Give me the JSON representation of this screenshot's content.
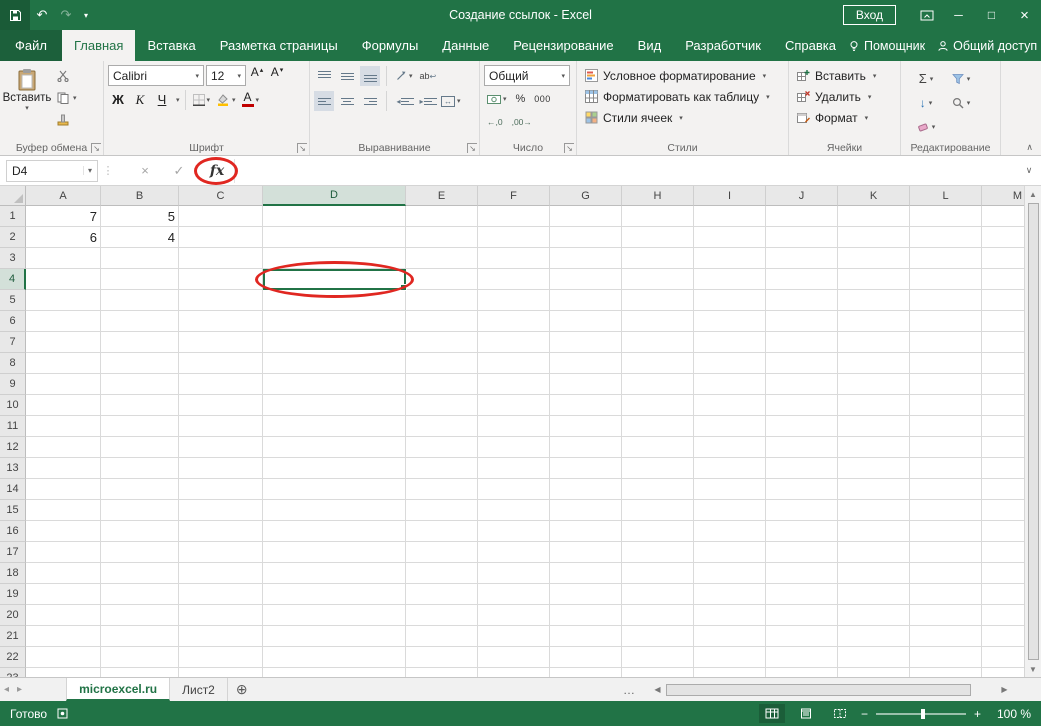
{
  "colors": {
    "accent": "#217346",
    "titlebar": "#217346",
    "ribbon_bg": "#F3F2F1",
    "annotation": "#E02721"
  },
  "titlebar": {
    "title": "Создание ссылок - Excel",
    "signin": "Вход"
  },
  "ribbon_tabs": {
    "file": "Файл",
    "active": "Главная",
    "items": [
      "Главная",
      "Вставка",
      "Разметка страницы",
      "Формулы",
      "Данные",
      "Рецензирование",
      "Вид",
      "Разработчик",
      "Справка"
    ],
    "assistant": "Помощник",
    "share": "Общий доступ"
  },
  "ribbon": {
    "clipboard": {
      "group": "Буфер обмена",
      "paste": "Вставить"
    },
    "font": {
      "group": "Шрифт",
      "family": "Calibri",
      "size": "12",
      "bold": "Ж",
      "italic": "К",
      "underline": "Ч"
    },
    "alignment": {
      "group": "Выравнивание",
      "wrap": "ab"
    },
    "number": {
      "group": "Число",
      "format": "Общий",
      "percent": "%",
      "thousands": "000",
      "dec_inc": "←,0",
      "dec_dec": ",00→"
    },
    "styles": {
      "group": "Стили",
      "items": [
        "Условное форматирование",
        "Форматировать как таблицу",
        "Стили ячеек"
      ]
    },
    "cells": {
      "group": "Ячейки",
      "items": [
        "Вставить",
        "Удалить",
        "Формат"
      ]
    },
    "editing": {
      "group": "Редактирование",
      "autosum": "Σ"
    }
  },
  "formula_bar": {
    "name_box": "D4",
    "fx": "fx",
    "formula": ""
  },
  "grid": {
    "columns": [
      "A",
      "B",
      "C",
      "D",
      "E",
      "F",
      "G",
      "H",
      "I",
      "J",
      "K",
      "L",
      "M"
    ],
    "rows": 23,
    "cells": {
      "A1": "7",
      "B1": "5",
      "A2": "6",
      "B2": "4"
    },
    "selected_cell": "D4",
    "selected_column": "D",
    "selected_row": "4"
  },
  "sheet_bar": {
    "tabs": [
      {
        "name": "microexcel.ru",
        "active": true
      },
      {
        "name": "Лист2",
        "active": false
      }
    ]
  },
  "status_bar": {
    "ready": "Готово",
    "zoom": "100 %"
  },
  "icons": {
    "dropdown": "▾",
    "launcher": "↘",
    "undo": "↶",
    "redo": "↷",
    "qat_menu": "▾",
    "minimize": "─",
    "maximize": "□",
    "close": "×",
    "cancel": "×",
    "enter": "✓",
    "separator_dots": "⋮",
    "expand_formula": "∨",
    "collapse_ribbon": "∧",
    "scroll_up": "▲",
    "scroll_down": "▼",
    "scroll_left": "◀",
    "scroll_right": "▶",
    "tab_nav_left": "◂",
    "tab_nav_right": "▸",
    "overflow_dots": "…",
    "new_sheet": "⊕",
    "fill_down": "↓",
    "merge_arrows": "↔",
    "wrap_arrow": "↩",
    "grow_font": "▴",
    "shrink_font": "▾",
    "font_letter": "А",
    "zoom_out": "−",
    "zoom_in": "+"
  }
}
